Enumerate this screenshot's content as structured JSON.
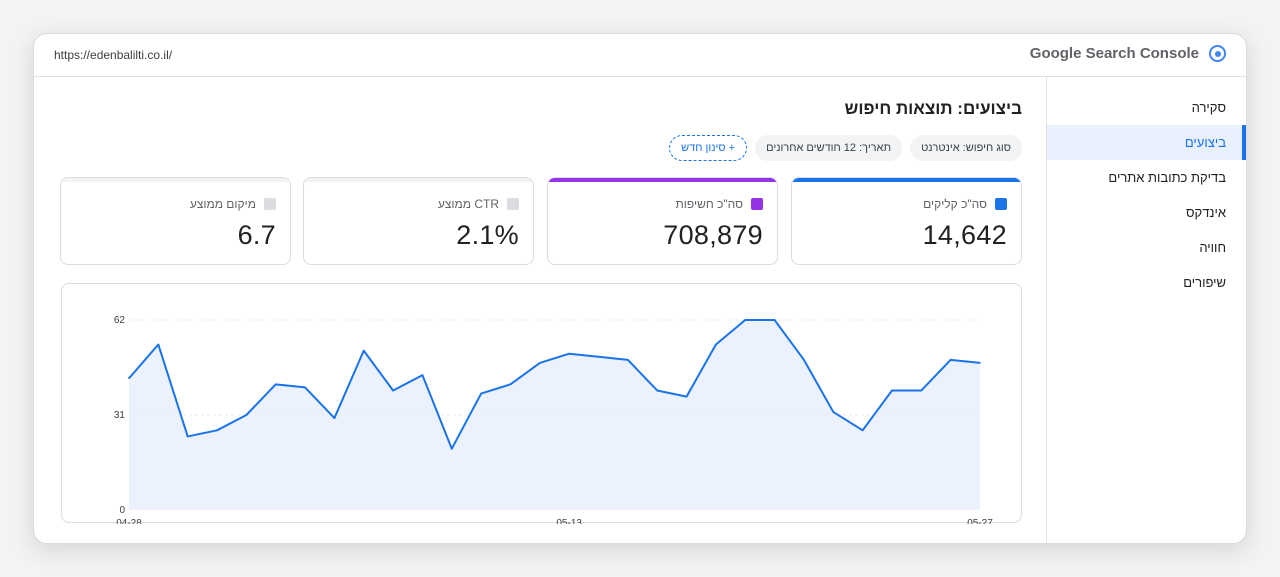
{
  "topbar": {
    "url": "https://edenbalilti.co.il/",
    "app_name": "Google Search Console",
    "app_icon": "target-icon"
  },
  "sidebar": {
    "items": [
      {
        "label": "סקירה",
        "active": false
      },
      {
        "label": "ביצועים",
        "active": true
      },
      {
        "label": "בדיקת כתובות אתרים",
        "active": false
      },
      {
        "label": "אינדקס",
        "active": false
      },
      {
        "label": "חוויה",
        "active": false
      },
      {
        "label": "שיפורים",
        "active": false
      }
    ]
  },
  "main": {
    "title": "ביצועים: תוצאות חיפוש",
    "filters": [
      {
        "label": "סוג חיפוש: אינטרנט"
      },
      {
        "label": "תאריך: 12 חודשים אחרונים"
      }
    ],
    "add_filter": {
      "plus": "+",
      "label": "סינון חדש"
    },
    "metrics": [
      {
        "label": "סה\"כ קליקים",
        "value": "14,642",
        "color": "#1a73e8",
        "selected": true
      },
      {
        "label": "סה\"כ חשיפות",
        "value": "708,879",
        "color": "#9334e6",
        "selected": true
      },
      {
        "label": "CTR ממוצע",
        "value": "2.1%",
        "color": "#dadce0",
        "selected": false
      },
      {
        "label": "מיקום ממוצע",
        "value": "6.7",
        "color": "#dadce0",
        "selected": false
      }
    ]
  },
  "chart_data": {
    "type": "area",
    "series": [
      {
        "values": [
          43,
          54,
          24,
          26,
          31,
          41,
          40,
          30,
          52,
          39,
          44,
          20,
          38,
          41,
          48,
          51,
          50,
          49,
          39,
          37,
          54,
          62,
          62,
          49,
          32,
          26,
          39,
          39,
          49,
          48
        ],
        "color": "#1a73e8"
      }
    ],
    "x_tick_labels": [
      "04-28",
      "05-13",
      "05-27"
    ],
    "x_tick_indices": [
      0,
      15,
      29
    ],
    "y_ticks": [
      0,
      31,
      62
    ],
    "ylim": [
      0,
      62
    ],
    "grid": true,
    "fill_color": "#e8f0fe"
  }
}
